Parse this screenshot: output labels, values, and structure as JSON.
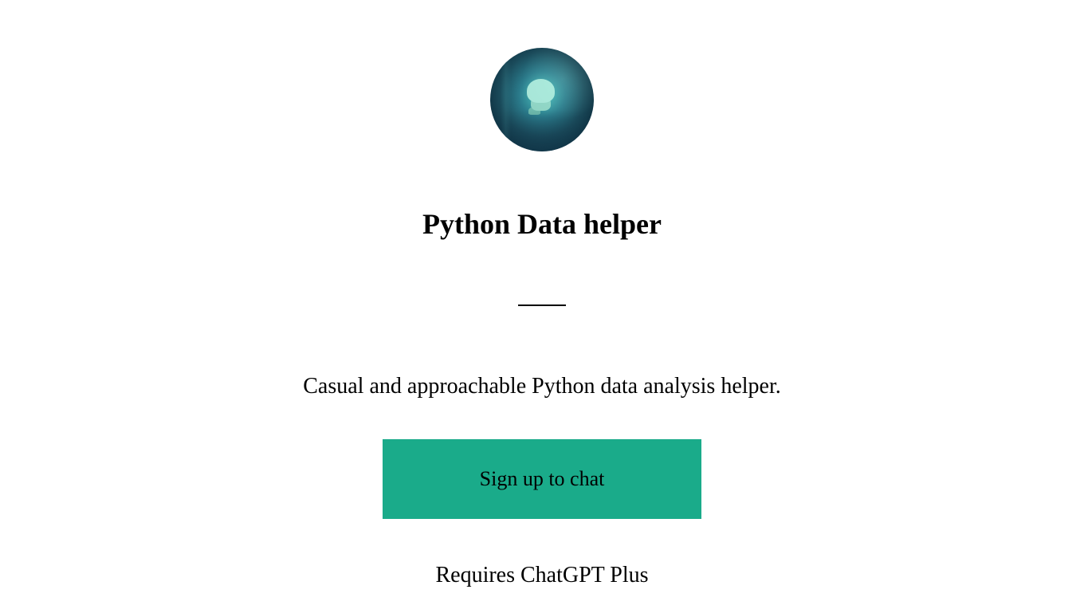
{
  "title": "Python Data helper",
  "description": "Casual and approachable Python data analysis helper.",
  "button_label": "Sign up to chat",
  "requires_text": "Requires ChatGPT Plus"
}
